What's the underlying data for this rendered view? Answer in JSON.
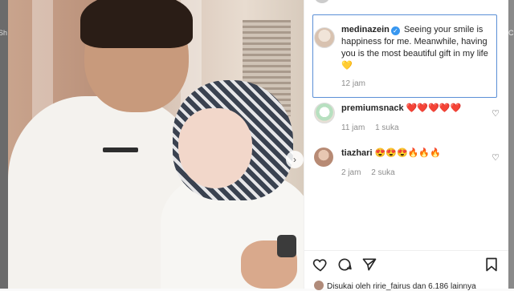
{
  "backdrop": {
    "left_strip_text": "Sh",
    "right_strip_text": "Ci"
  },
  "post": {
    "nav_arrow": "›",
    "caption": {
      "username": "medinazein",
      "verified": true,
      "text": "Seeing your smile is happiness for me. Meanwhile, having you is the most beautiful gift in my life 💛",
      "time": "12 jam"
    },
    "comments": [
      {
        "username": "premiumsnack",
        "text": "❤️❤️❤️❤️❤️",
        "time": "11 jam",
        "likes": "1 suka"
      },
      {
        "username": "tiazhari",
        "text": "😍😍😍🔥🔥🔥",
        "time": "2 jam",
        "likes": "2 suka"
      }
    ],
    "actions": {
      "like_icon": "heart-icon",
      "comment_icon": "comment-icon",
      "share_icon": "share-icon",
      "save_icon": "bookmark-icon"
    },
    "liked_by": "Disukai oleh ririe_fairus dan 6.186 lainnya"
  }
}
